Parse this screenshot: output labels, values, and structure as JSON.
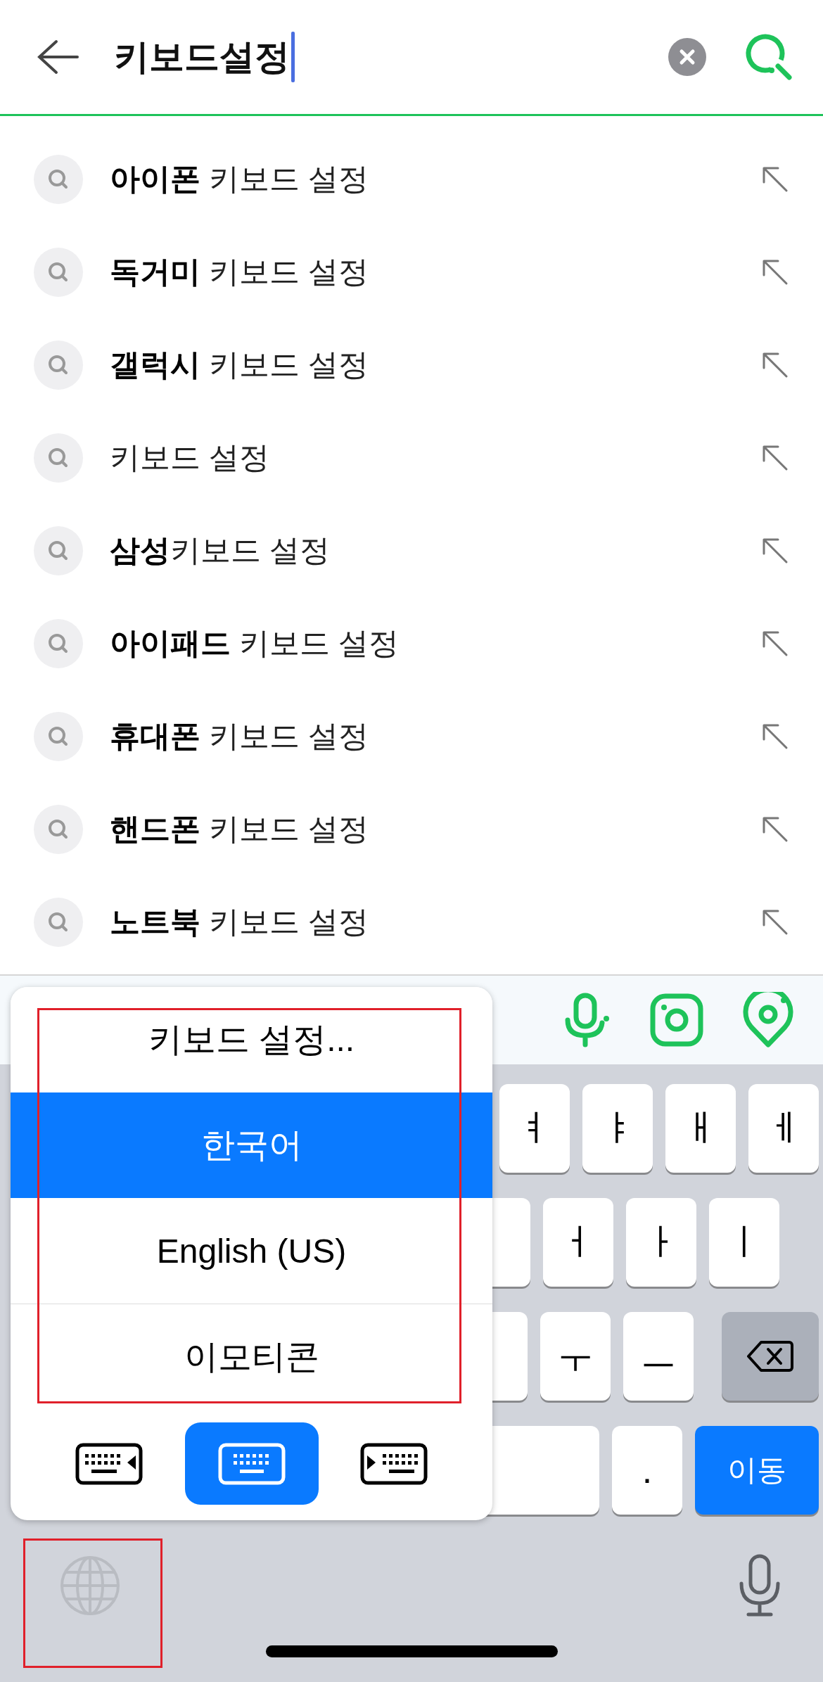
{
  "search": {
    "query": "키보드설정"
  },
  "suggestions": [
    {
      "text": "**아이폰** 키보드 설정"
    },
    {
      "text": "**독거미** 키보드 설정"
    },
    {
      "text": "**갤럭시** 키보드 설정"
    },
    {
      "text": "키보드 설정"
    },
    {
      "text": "**삼성**키보드 설정"
    },
    {
      "text": "**아이패드** 키보드 설정"
    },
    {
      "text": "**휴대폰** 키보드 설정"
    },
    {
      "text": "**핸드폰** 키보드 설정"
    },
    {
      "text": "**노트북** 키보드 설정"
    }
  ],
  "keyboard": {
    "rows": [
      [
        {
          "kind": "letter",
          "label": "ㅕ"
        },
        {
          "kind": "letter",
          "label": "ㅑ"
        },
        {
          "kind": "letter",
          "label": "ㅐ"
        },
        {
          "kind": "letter",
          "label": "ㅔ"
        }
      ],
      [
        {
          "kind": "blank"
        },
        {
          "kind": "letter",
          "label": "ㅓ"
        },
        {
          "kind": "letter",
          "label": "ㅏ"
        },
        {
          "kind": "letter",
          "label": "ㅣ"
        }
      ],
      [
        {
          "kind": "blank"
        },
        {
          "kind": "letter",
          "label": "ㅜ"
        },
        {
          "kind": "letter",
          "label": "ㅡ"
        },
        {
          "kind": "delete"
        }
      ],
      [
        {
          "kind": "space"
        },
        {
          "kind": "letter",
          "label": "."
        },
        {
          "kind": "go",
          "label": "이동"
        }
      ]
    ]
  },
  "input_menu": {
    "items": [
      {
        "label": "키보드 설정...",
        "selected": false
      },
      {
        "label": "한국어",
        "selected": true
      },
      {
        "label": "English (US)",
        "selected": false
      },
      {
        "label": "이모티콘",
        "selected": false
      }
    ],
    "layouts": [
      {
        "kind": "left",
        "selected": false
      },
      {
        "kind": "center",
        "selected": true
      },
      {
        "kind": "right",
        "selected": false
      }
    ]
  }
}
